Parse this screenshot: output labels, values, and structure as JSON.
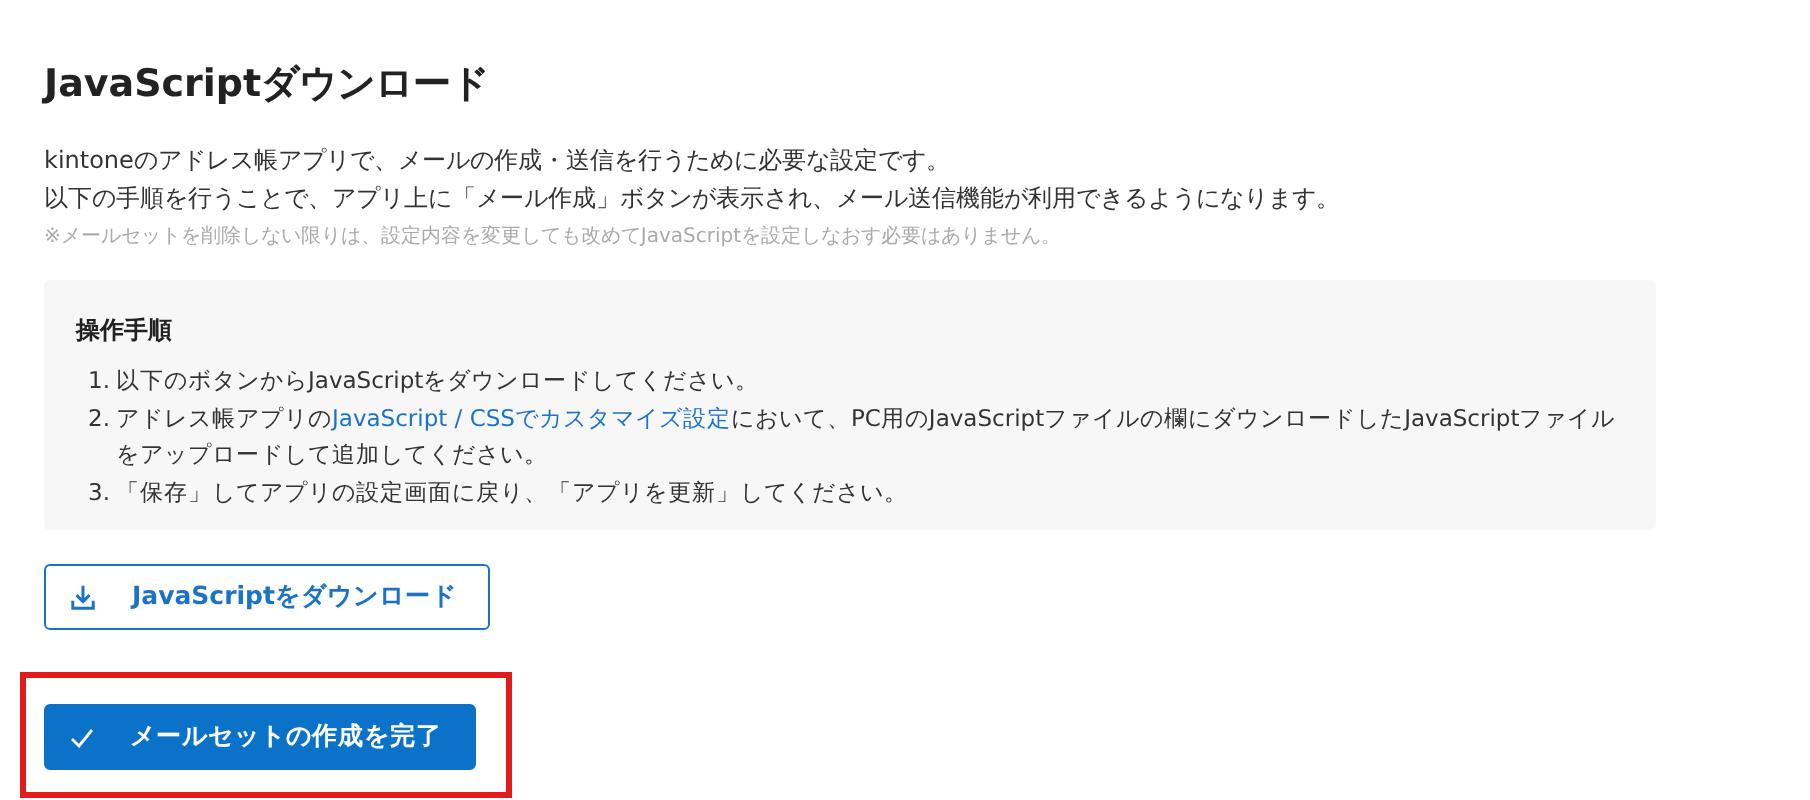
{
  "title": "JavaScriptダウンロード",
  "description": [
    "kintoneのアドレス帳アプリで、メールの作成・送信を行うために必要な設定です。",
    "以下の手順を行うことで、アプリ上に「メール作成」ボタンが表示され、メール送信機能が利用できるようになります。"
  ],
  "note": "※メールセットを削除しない限りは、設定内容を変更しても改めてJavaScriptを設定しなおす必要はありません。",
  "steps_panel": {
    "heading": "操作手順",
    "steps": [
      {
        "number": "1.",
        "text": "以下のボタンからJavaScriptをダウンロードしてください。"
      },
      {
        "number": "2.",
        "text": "アドレス帳アプリの",
        "link": "JavaScript / CSSでカスタマイズ設定",
        "text_after": "において、PC用のJavaScriptファイルの欄にダウンロードしたJavaScriptファイルをアップロードして追加してください。"
      },
      {
        "number": "3.",
        "text": "「保存」してアプリの設定画面に戻り、「アプリを更新」してください。"
      }
    ]
  },
  "buttons": [
    {
      "kind": "outline",
      "label": "JavaScriptをダウンロード",
      "highlighted": false
    },
    {
      "kind": "primary",
      "label": "メールセットの作成を完了",
      "highlighted": true
    }
  ]
}
